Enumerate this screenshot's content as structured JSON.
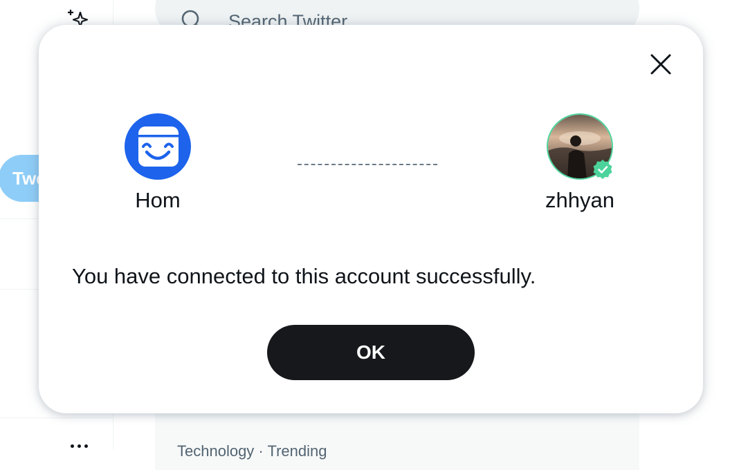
{
  "background": {
    "search": {
      "placeholder": "Search Twitter",
      "icon": "search-icon"
    },
    "nav": {
      "tweet_label": "Tweet",
      "top_icon": "sparkle-icon",
      "more_icon": "more-icon"
    },
    "trends": {
      "meta": "Technology · Trending"
    }
  },
  "dialog": {
    "close_icon": "close-icon",
    "app": {
      "name": "Hom",
      "logo_icon": "smiling-mask-icon",
      "color": "#1d63ec"
    },
    "user": {
      "name": "zhhyan",
      "verified_color": "#4cd39b"
    },
    "message": "You have connected to this account successfully.",
    "ok_label": "OK"
  },
  "colors": {
    "primary_button": "#16181c",
    "tweet_button_disabled": "#8ecdf8",
    "search_bg": "#eff3f4"
  }
}
